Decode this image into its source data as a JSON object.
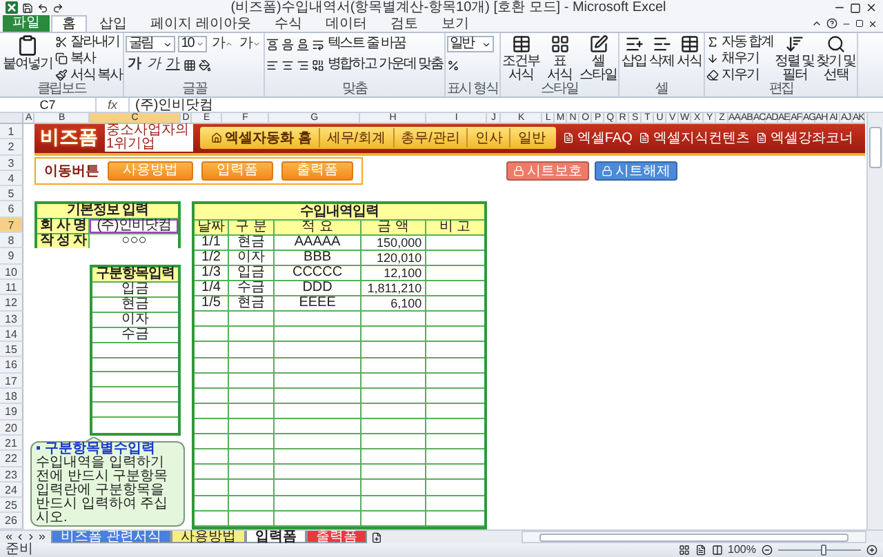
{
  "window": {
    "title": "(비즈폼)수입내역서(항목별계산-항목10개) [호환 모드] - Microsoft Excel"
  },
  "ribbon": {
    "tabs": [
      {
        "label": "파일",
        "kind": "file",
        "selected": false
      },
      {
        "label": "홈",
        "kind": "tab",
        "selected": true
      },
      {
        "label": "삽입",
        "kind": "tab",
        "selected": false
      },
      {
        "label": "페이지 레이아웃",
        "kind": "tab",
        "selected": false
      },
      {
        "label": "수식",
        "kind": "tab",
        "selected": false
      },
      {
        "label": "데이터",
        "kind": "tab",
        "selected": false
      },
      {
        "label": "검토",
        "kind": "tab",
        "selected": false
      },
      {
        "label": "보기",
        "kind": "tab",
        "selected": false
      }
    ],
    "clipboard": {
      "label": "클립보드",
      "paste": "붙여넣기",
      "cut": "잘라내기",
      "copy": "복사",
      "format_painter": "서식 복사"
    },
    "font": {
      "label": "글꼴",
      "name": "굴림",
      "size": "10",
      "styles": [
        {
          "label": "가",
          "kind": "grow"
        },
        {
          "label": "가",
          "kind": "shrink"
        },
        {
          "label": "가",
          "kind": "bold"
        },
        {
          "label": "가",
          "kind": "italic"
        },
        {
          "label": "가",
          "kind": "underline"
        }
      ]
    },
    "alignment": {
      "label": "맞춤",
      "wrap": "텍스트 줄 바꿈",
      "merge": "병합하고 가운데 맞춤"
    },
    "number": {
      "label": "표시 형식",
      "format": "일반"
    },
    "styles": {
      "label": "스타일",
      "buttons": [
        "조건부 서식",
        "표 서식",
        "셀 스타일"
      ]
    },
    "cells": {
      "label": "셀",
      "buttons": [
        "삽입",
        "삭제",
        "서식"
      ]
    },
    "editing": {
      "label": "편집",
      "small": [
        "자동 합계",
        "채우기",
        "지우기"
      ],
      "large": [
        "정렬 및 필터",
        "찾기 및 선택"
      ]
    }
  },
  "formula_bar": {
    "name_box": "C7",
    "fx": "fx",
    "value": "(주)인비닷컴"
  },
  "sheet": {
    "column_headers": [
      {
        "label": "A",
        "selected": false
      },
      {
        "label": "B",
        "selected": false
      },
      {
        "label": "C",
        "selected": true
      },
      {
        "label": "D",
        "selected": false
      },
      {
        "label": "E",
        "selected": false
      },
      {
        "label": "F",
        "selected": false
      },
      {
        "label": "G",
        "selected": false
      },
      {
        "label": "H",
        "selected": false
      },
      {
        "label": "I",
        "selected": false
      },
      {
        "label": "J",
        "selected": false
      },
      {
        "label": "K",
        "selected": false
      },
      {
        "label": "L",
        "selected": false
      },
      {
        "label": "M",
        "selected": false
      },
      {
        "label": "N",
        "selected": false
      },
      {
        "label": "O",
        "selected": false
      },
      {
        "label": "P",
        "selected": false
      },
      {
        "label": "Q",
        "selected": false
      },
      {
        "label": "R",
        "selected": false
      },
      {
        "label": "S",
        "selected": false
      },
      {
        "label": "T",
        "selected": false
      },
      {
        "label": "U",
        "selected": false
      },
      {
        "label": "V",
        "selected": false
      },
      {
        "label": "W",
        "selected": false
      },
      {
        "label": "X",
        "selected": false
      },
      {
        "label": "Y",
        "selected": false
      },
      {
        "label": "Z",
        "selected": false
      },
      {
        "label": "AA",
        "selected": false
      },
      {
        "label": "AB",
        "selected": false
      },
      {
        "label": "AC",
        "selected": false
      },
      {
        "label": "AD",
        "selected": false
      },
      {
        "label": "AE",
        "selected": false
      },
      {
        "label": "AF",
        "selected": false
      },
      {
        "label": "AG",
        "selected": false
      },
      {
        "label": "AH",
        "selected": false
      },
      {
        "label": "AI",
        "selected": false
      },
      {
        "label": "AJ",
        "selected": false
      },
      {
        "label": "AK",
        "selected": false
      }
    ],
    "row_headers": [
      {
        "label": "1",
        "selected": false
      },
      {
        "label": "2",
        "selected": false
      },
      {
        "label": "3",
        "selected": false
      },
      {
        "label": "4",
        "selected": false
      },
      {
        "label": "5",
        "selected": false
      },
      {
        "label": "6",
        "selected": false
      },
      {
        "label": "7",
        "selected": true
      },
      {
        "label": "8",
        "selected": false
      },
      {
        "label": "9",
        "selected": false
      },
      {
        "label": "10",
        "selected": false
      },
      {
        "label": "11",
        "selected": false
      },
      {
        "label": "12",
        "selected": false
      },
      {
        "label": "13",
        "selected": false
      },
      {
        "label": "14",
        "selected": false
      },
      {
        "label": "15",
        "selected": false
      },
      {
        "label": "16",
        "selected": false
      },
      {
        "label": "17",
        "selected": false
      },
      {
        "label": "18",
        "selected": false
      },
      {
        "label": "19",
        "selected": false
      },
      {
        "label": "20",
        "selected": false
      },
      {
        "label": "21",
        "selected": false
      },
      {
        "label": "22",
        "selected": false
      },
      {
        "label": "23",
        "selected": false
      },
      {
        "label": "24",
        "selected": false
      },
      {
        "label": "25",
        "selected": false
      },
      {
        "label": "26",
        "selected": false
      }
    ],
    "banner": {
      "logo": "비즈폼",
      "tagline": "중소사업자의 1위기업",
      "nav": [
        {
          "label": "엑셀자동화 홈",
          "kind": "home"
        },
        {
          "label": "세무/회계",
          "kind": "link"
        },
        {
          "label": "총무/관리",
          "kind": "link"
        },
        {
          "label": "인사",
          "kind": "link"
        },
        {
          "label": "일반",
          "kind": "link"
        }
      ],
      "links": [
        "엑셀FAQ",
        "엑셀지식컨텐츠",
        "엑셀강좌코너"
      ]
    },
    "move_buttons": {
      "label": "이동버튼",
      "buttons": [
        "사용방법",
        "입력폼",
        "출력폼"
      ]
    },
    "protect_buttons": [
      {
        "label": "시트보호",
        "color": "#f07a68"
      },
      {
        "label": "시트해제",
        "color": "#4a8ad8"
      }
    ],
    "basic_info": {
      "title": "기본정보 입력",
      "rows": [
        {
          "label": "회 사 명",
          "value": "(주)인비닷컴",
          "selected": true
        },
        {
          "label": "작 성 자",
          "value": "○○○",
          "selected": false
        }
      ]
    },
    "category_input": {
      "title": "구분항목입력",
      "items": [
        "입금",
        "현금",
        "이자",
        "수금"
      ]
    },
    "income": {
      "title": "수입내역입력",
      "columns": [
        "날짜",
        "구 분",
        "적 요",
        "금 액",
        "비 고"
      ],
      "rows": [
        {
          "date": "1/1",
          "category": "현금",
          "description": "AAAAA",
          "amount": "150,000"
        },
        {
          "date": "1/2",
          "category": "이자",
          "description": "BBB",
          "amount": "120,010"
        },
        {
          "date": "1/3",
          "category": "입금",
          "description": "CCCCC",
          "amount": "12,100"
        },
        {
          "date": "1/4",
          "category": "수금",
          "description": "DDD",
          "amount": "1,811,210"
        },
        {
          "date": "1/5",
          "category": "현금",
          "description": "EEEE",
          "amount": "6,100"
        }
      ]
    },
    "callout": {
      "title": "▪ 구분항목별수입력",
      "text": "수입내역을 입력하기 전에 반드시 구분항목입력란에 구분항목을 반드시 입력하여 주십시오."
    }
  },
  "sheet_tabs": [
    {
      "label": "비즈폼 관련서식",
      "color": "#4a7fe0",
      "selected": false
    },
    {
      "label": "사용방법",
      "color": "#f5ee80",
      "selected": false
    },
    {
      "label": "입력폼",
      "color": "#ffffff",
      "selected": true
    },
    {
      "label": "출력폼",
      "color": "#e83a3a",
      "selected": false
    }
  ],
  "status_bar": {
    "status": "준비",
    "zoom": {
      "reading": "100%",
      "level": 0.55
    }
  }
}
